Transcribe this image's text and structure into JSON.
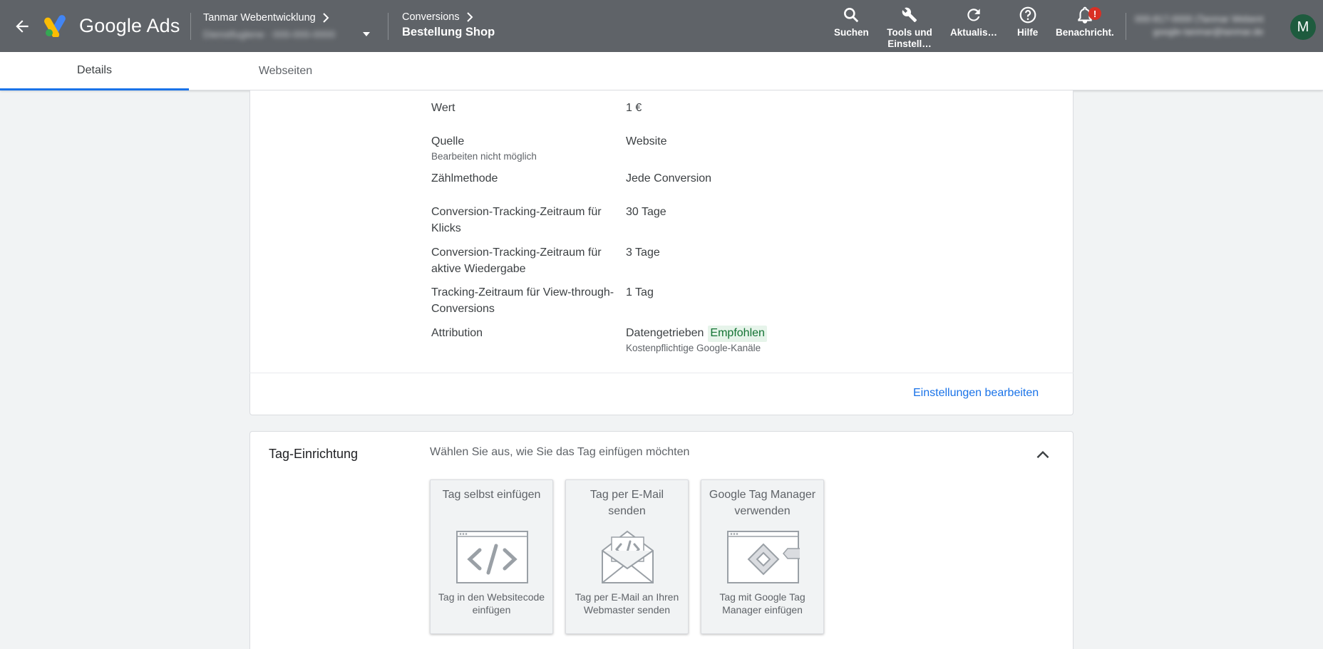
{
  "header": {
    "brand": "Google Ads",
    "account_name": "Tanmar Webentwicklung",
    "account_sub": "Dienstfuglene · 000-000-0000",
    "breadcrumb_parent": "Conversions",
    "breadcrumb_current": "Bestellung Shop",
    "tools": [
      {
        "label": "Suchen",
        "icon": "search-icon"
      },
      {
        "label": "Tools und Einstell…",
        "icon": "wrench-icon"
      },
      {
        "label": "Aktualis…",
        "icon": "refresh-icon"
      },
      {
        "label": "Hilfe",
        "icon": "help-icon"
      },
      {
        "label": "Benachricht.",
        "icon": "bell-icon",
        "badge": "!"
      }
    ],
    "user_line1": "000-817-0000 (Tanmar Webent",
    "user_line2": "google-tanmar@tanmar.de",
    "avatar_letter": "M",
    "colors": {
      "bar": "#5f6368",
      "avatar": "#1e5b3e",
      "badge": "#d93025"
    }
  },
  "tabs": [
    {
      "label": "Details",
      "active": true
    },
    {
      "label": "Webseiten",
      "active": false
    }
  ],
  "settings": {
    "rows": [
      {
        "label": "Wert",
        "value": "1 €"
      },
      {
        "label": "Quelle",
        "hint": "Bearbeiten nicht möglich",
        "value": "Website"
      },
      {
        "label": "Zählmethode",
        "value": "Jede Conversion"
      },
      {
        "label": "Conversion-Tracking-Zeitraum für Klicks",
        "value": "30 Tage"
      },
      {
        "label": "Conversion-Tracking-Zeitraum für aktive Wiedergabe",
        "value": "3 Tage"
      },
      {
        "label": "Tracking-Zeitraum für View-through-Conversions",
        "value": "1 Tag"
      },
      {
        "label": "Attribution",
        "value": "Datengetrieben",
        "chip": "Empfohlen",
        "value_hint": "Kostenpflichtige Google-Kanäle"
      }
    ],
    "edit_link": "Einstellungen bearbeiten"
  },
  "tag_setup": {
    "title": "Tag-Einrichtung",
    "description": "Wählen Sie aus, wie Sie das Tag einfügen möchten",
    "options": [
      {
        "title": "Tag selbst einfügen",
        "desc": "Tag in den Websitecode einfügen",
        "icon": "code-window-icon"
      },
      {
        "title": "Tag per E-Mail senden",
        "desc": "Tag per E-Mail an Ihren Webmaster senden",
        "icon": "email-code-icon"
      },
      {
        "title": "Google Tag Manager verwenden",
        "desc": "Tag mit Google Tag Manager einfügen",
        "icon": "tag-manager-icon"
      }
    ]
  }
}
